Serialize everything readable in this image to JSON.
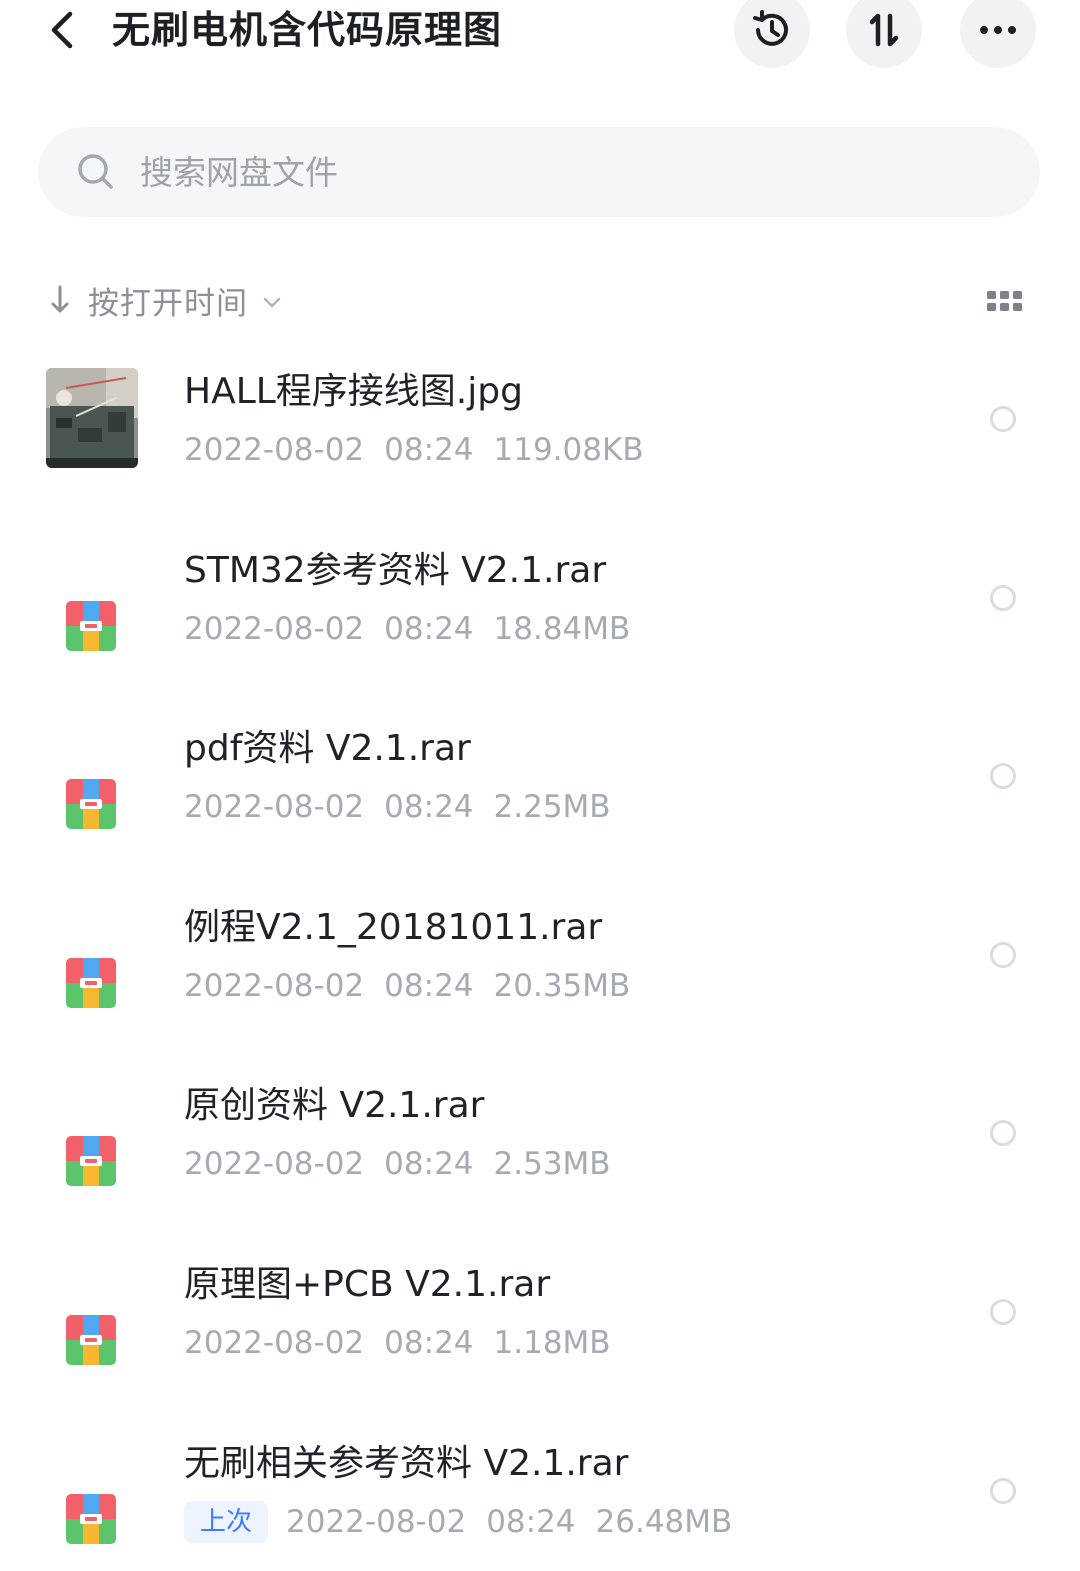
{
  "header": {
    "title": "无刷电机含代码原理图",
    "back_icon": "chevron-left-icon",
    "history_icon": "history-clock-icon",
    "sort_icon": "transfer-arrows-icon",
    "more_icon": "more-dots-icon"
  },
  "search": {
    "placeholder": "搜索网盘文件"
  },
  "sortbar": {
    "label": "按打开时间",
    "arrow_icon": "arrow-down-icon",
    "chevron_icon": "chevron-down-icon",
    "view_icon": "grid-view-icon"
  },
  "files": [
    {
      "name": "HALL程序接线图.jpg",
      "date": "2022-08-02",
      "time": "08:24",
      "size": "119.08KB",
      "type": "image",
      "badge": ""
    },
    {
      "name": "STM32参考资料 V2.1.rar",
      "date": "2022-08-02",
      "time": "08:24",
      "size": "18.84MB",
      "type": "rar",
      "badge": ""
    },
    {
      "name": "pdf资料 V2.1.rar",
      "date": "2022-08-02",
      "time": "08:24",
      "size": "2.25MB",
      "type": "rar",
      "badge": ""
    },
    {
      "name": "例程V2.1_20181011.rar",
      "date": "2022-08-02",
      "time": "08:24",
      "size": "20.35MB",
      "type": "rar",
      "badge": ""
    },
    {
      "name": "原创资料 V2.1.rar",
      "date": "2022-08-02",
      "time": "08:24",
      "size": "2.53MB",
      "type": "rar",
      "badge": ""
    },
    {
      "name": "原理图+PCB V2.1.rar",
      "date": "2022-08-02",
      "time": "08:24",
      "size": "1.18MB",
      "type": "rar",
      "badge": ""
    },
    {
      "name": "无刷相关参考资料 V2.1.rar",
      "date": "2022-08-02",
      "time": "08:24",
      "size": "26.48MB",
      "type": "rar",
      "badge": "上次"
    }
  ],
  "colors": {
    "accent": "#3d7cff",
    "rar_red": "#f2606a",
    "rar_blue": "#4fa8f0",
    "rar_yellow": "#f7b731",
    "rar_green": "#5cc46a"
  }
}
